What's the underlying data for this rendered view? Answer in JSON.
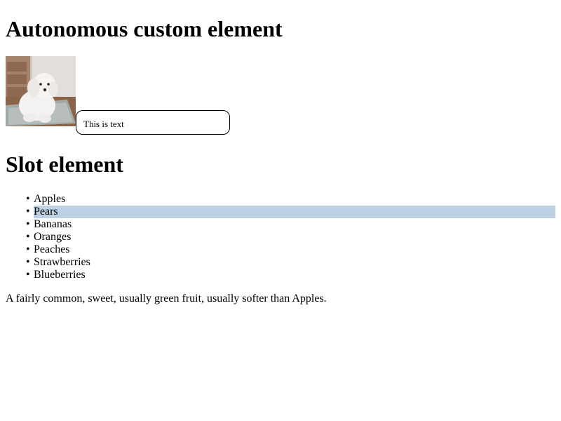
{
  "autonomous": {
    "heading": "Autonomous custom element",
    "image_alt": "white fluffy dog",
    "text_box": "This is text"
  },
  "slot": {
    "heading": "Slot element",
    "items": [
      {
        "label": "Apples",
        "selected": false
      },
      {
        "label": "Pears",
        "selected": true
      },
      {
        "label": "Bananas",
        "selected": false
      },
      {
        "label": "Oranges",
        "selected": false
      },
      {
        "label": "Peaches",
        "selected": false
      },
      {
        "label": "Strawberries",
        "selected": false
      },
      {
        "label": "Blueberries",
        "selected": false
      }
    ],
    "description": "A fairly common, sweet, usually green fruit, usually softer than Apples."
  },
  "colors": {
    "selection": "#bcd1e3"
  }
}
